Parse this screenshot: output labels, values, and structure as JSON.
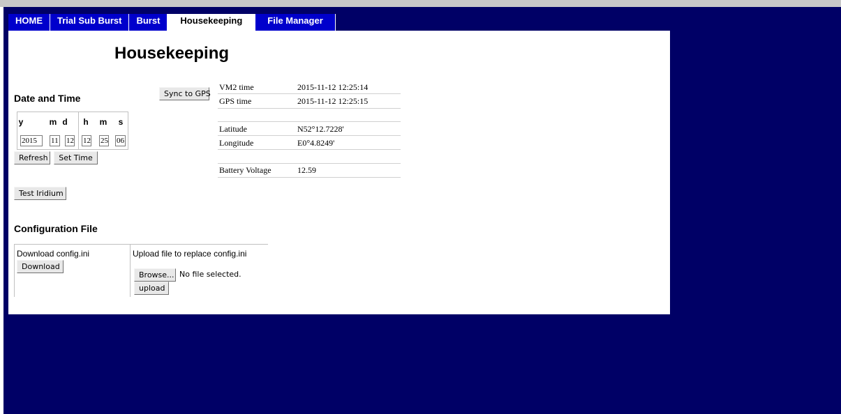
{
  "nav": {
    "tabs": [
      {
        "label": "HOME"
      },
      {
        "label": "Trial Sub Burst"
      },
      {
        "label": "Burst"
      },
      {
        "label": "Housekeeping",
        "active": true
      },
      {
        "label": "File Manager"
      }
    ]
  },
  "page": {
    "title": "Housekeeping"
  },
  "datetime": {
    "section_title": "Date and Time",
    "headers": [
      "y",
      "m",
      "d",
      "h",
      "m",
      "s"
    ],
    "values": [
      "2015",
      "11",
      "12",
      "12",
      "25",
      "06"
    ],
    "refresh_label": "Refresh",
    "set_time_label": "Set Time",
    "sync_label": "Sync to GPS",
    "test_iridium_label": "Test Iridium"
  },
  "info": {
    "vm2_time_label": "VM2 time",
    "vm2_time": "2015-11-12 12:25:14",
    "gps_time_label": "GPS time",
    "gps_time": "2015-11-12 12:25:15",
    "latitude_label": "Latitude",
    "latitude": "N52°12.7228'",
    "longitude_label": "Longitude",
    "longitude": "E0°4.8249'",
    "battery_label": "Battery Voltage",
    "battery": "12.59"
  },
  "config": {
    "section_title": "Configuration File",
    "download_text": "Download config.ini",
    "download_label": "Download",
    "upload_text": "Upload file to replace config.ini",
    "browse_label": "Browse...",
    "file_status": "No file selected.",
    "upload_label": "upload"
  },
  "colors": {
    "background": "#000066",
    "tab": "#0000cc",
    "panel": "#ffffff"
  }
}
